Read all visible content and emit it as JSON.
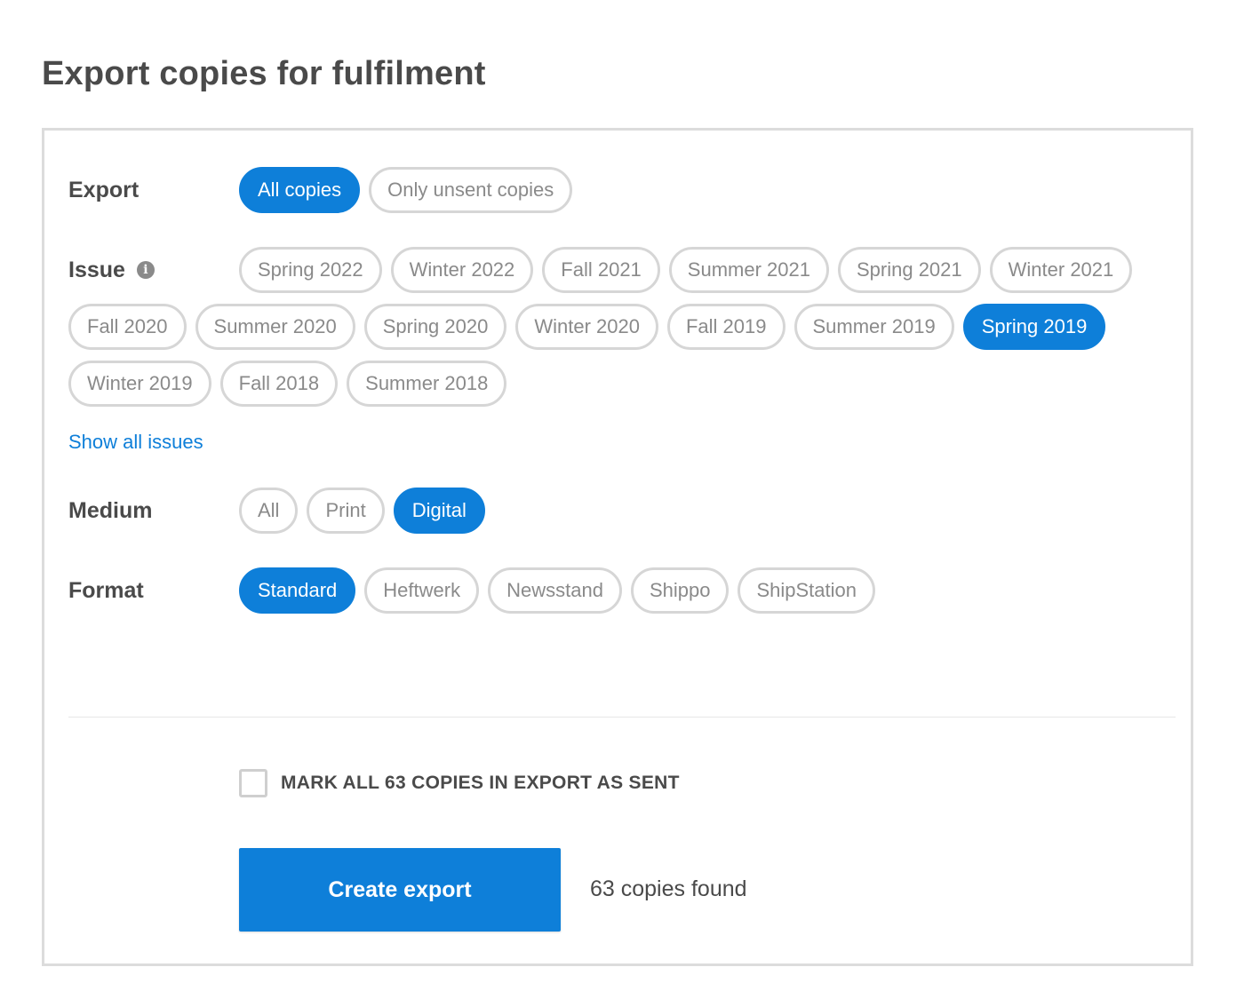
{
  "page": {
    "title": "Export copies for fulfilment"
  },
  "export": {
    "label": "Export",
    "options": [
      {
        "label": "All copies",
        "selected": true
      },
      {
        "label": "Only unsent copies",
        "selected": false
      }
    ]
  },
  "issue": {
    "label": "Issue",
    "info_icon": "info-icon",
    "options": [
      {
        "label": "Spring 2022",
        "selected": false
      },
      {
        "label": "Winter 2022",
        "selected": false
      },
      {
        "label": "Fall 2021",
        "selected": false
      },
      {
        "label": "Summer 2021",
        "selected": false
      },
      {
        "label": "Spring 2021",
        "selected": false
      },
      {
        "label": "Winter 2021",
        "selected": false
      },
      {
        "label": "Fall 2020",
        "selected": false
      },
      {
        "label": "Summer 2020",
        "selected": false
      },
      {
        "label": "Spring 2020",
        "selected": false
      },
      {
        "label": "Winter 2020",
        "selected": false
      },
      {
        "label": "Fall 2019",
        "selected": false
      },
      {
        "label": "Summer 2019",
        "selected": false
      },
      {
        "label": "Spring 2019",
        "selected": true
      },
      {
        "label": "Winter 2019",
        "selected": false
      },
      {
        "label": "Fall 2018",
        "selected": false
      },
      {
        "label": "Summer 2018",
        "selected": false
      }
    ],
    "show_all_link": "Show all issues"
  },
  "medium": {
    "label": "Medium",
    "options": [
      {
        "label": "All",
        "selected": false
      },
      {
        "label": "Print",
        "selected": false
      },
      {
        "label": "Digital",
        "selected": true
      }
    ]
  },
  "format": {
    "label": "Format",
    "options": [
      {
        "label": "Standard",
        "selected": true
      },
      {
        "label": "Heftwerk",
        "selected": false
      },
      {
        "label": "Newsstand",
        "selected": false
      },
      {
        "label": "Shippo",
        "selected": false
      },
      {
        "label": "ShipStation",
        "selected": false
      }
    ]
  },
  "footer": {
    "mark_sent_label": "MARK ALL 63 COPIES IN EXPORT AS SENT",
    "mark_sent_checked": false,
    "create_button": "Create export",
    "copies_found": "63 copies found"
  },
  "colors": {
    "accent": "#0e7fd9",
    "text": "#4a4a4a",
    "muted": "#8a8a8a",
    "border": "#d6d6d6"
  }
}
